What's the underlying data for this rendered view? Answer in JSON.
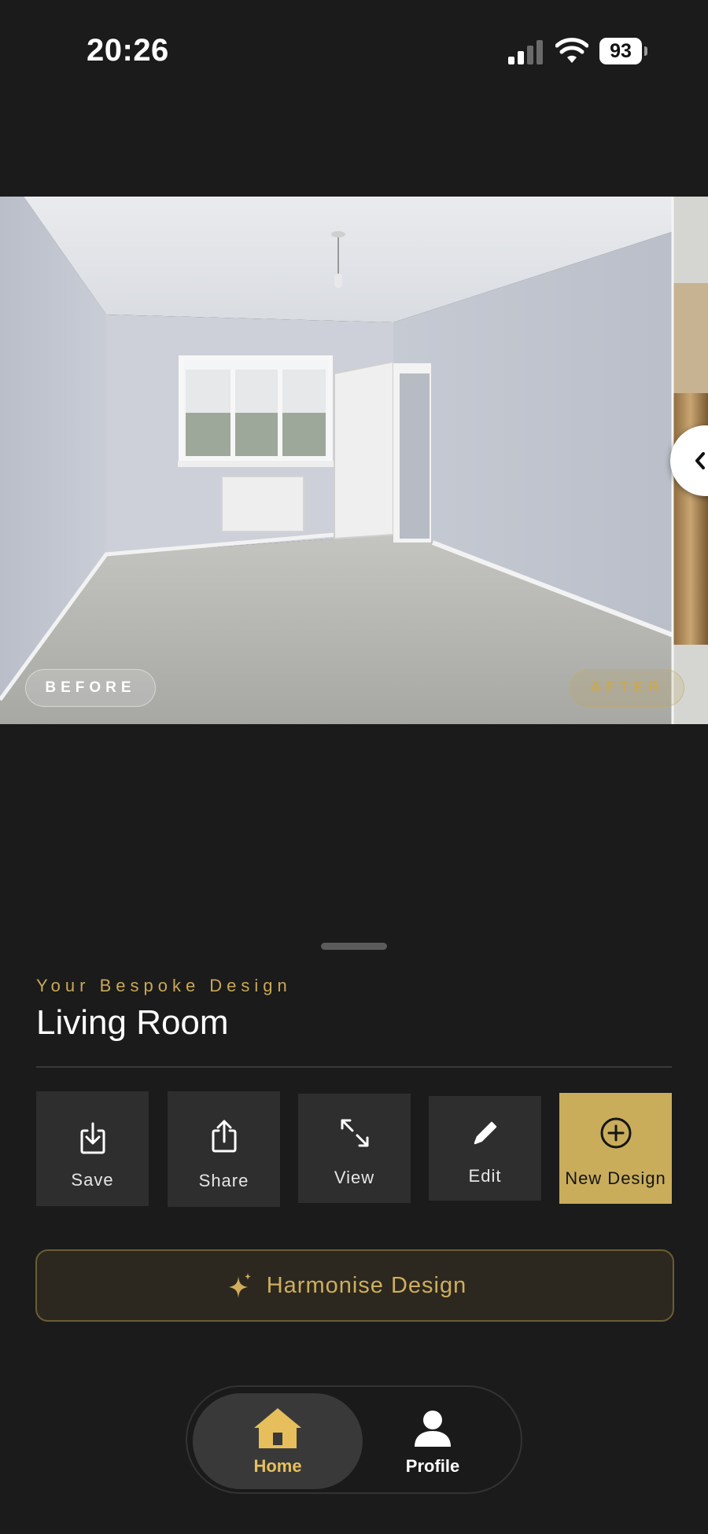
{
  "status_bar": {
    "time": "20:26",
    "battery": "93"
  },
  "comparison": {
    "before_label": "BEFORE",
    "after_label": "AFTER"
  },
  "design": {
    "subtitle": "Your Bespoke Design",
    "room_name": "Living Room"
  },
  "actions": {
    "save": "Save",
    "share": "Share",
    "view": "View",
    "edit": "Edit",
    "new_design": "New Design"
  },
  "harmonise_label": "Harmonise Design",
  "tabs": {
    "home": "Home",
    "profile": "Profile"
  },
  "colors": {
    "accent": "#c9ad5b",
    "background": "#1b1b1b",
    "button": "#2e2e2e"
  },
  "icons": [
    "signal-icon",
    "wifi-icon",
    "battery-icon",
    "chevron-left-icon",
    "download-icon",
    "share-icon",
    "expand-icon",
    "pencil-icon",
    "plus-circle-icon",
    "sparkle-icon",
    "home-icon",
    "person-icon"
  ]
}
